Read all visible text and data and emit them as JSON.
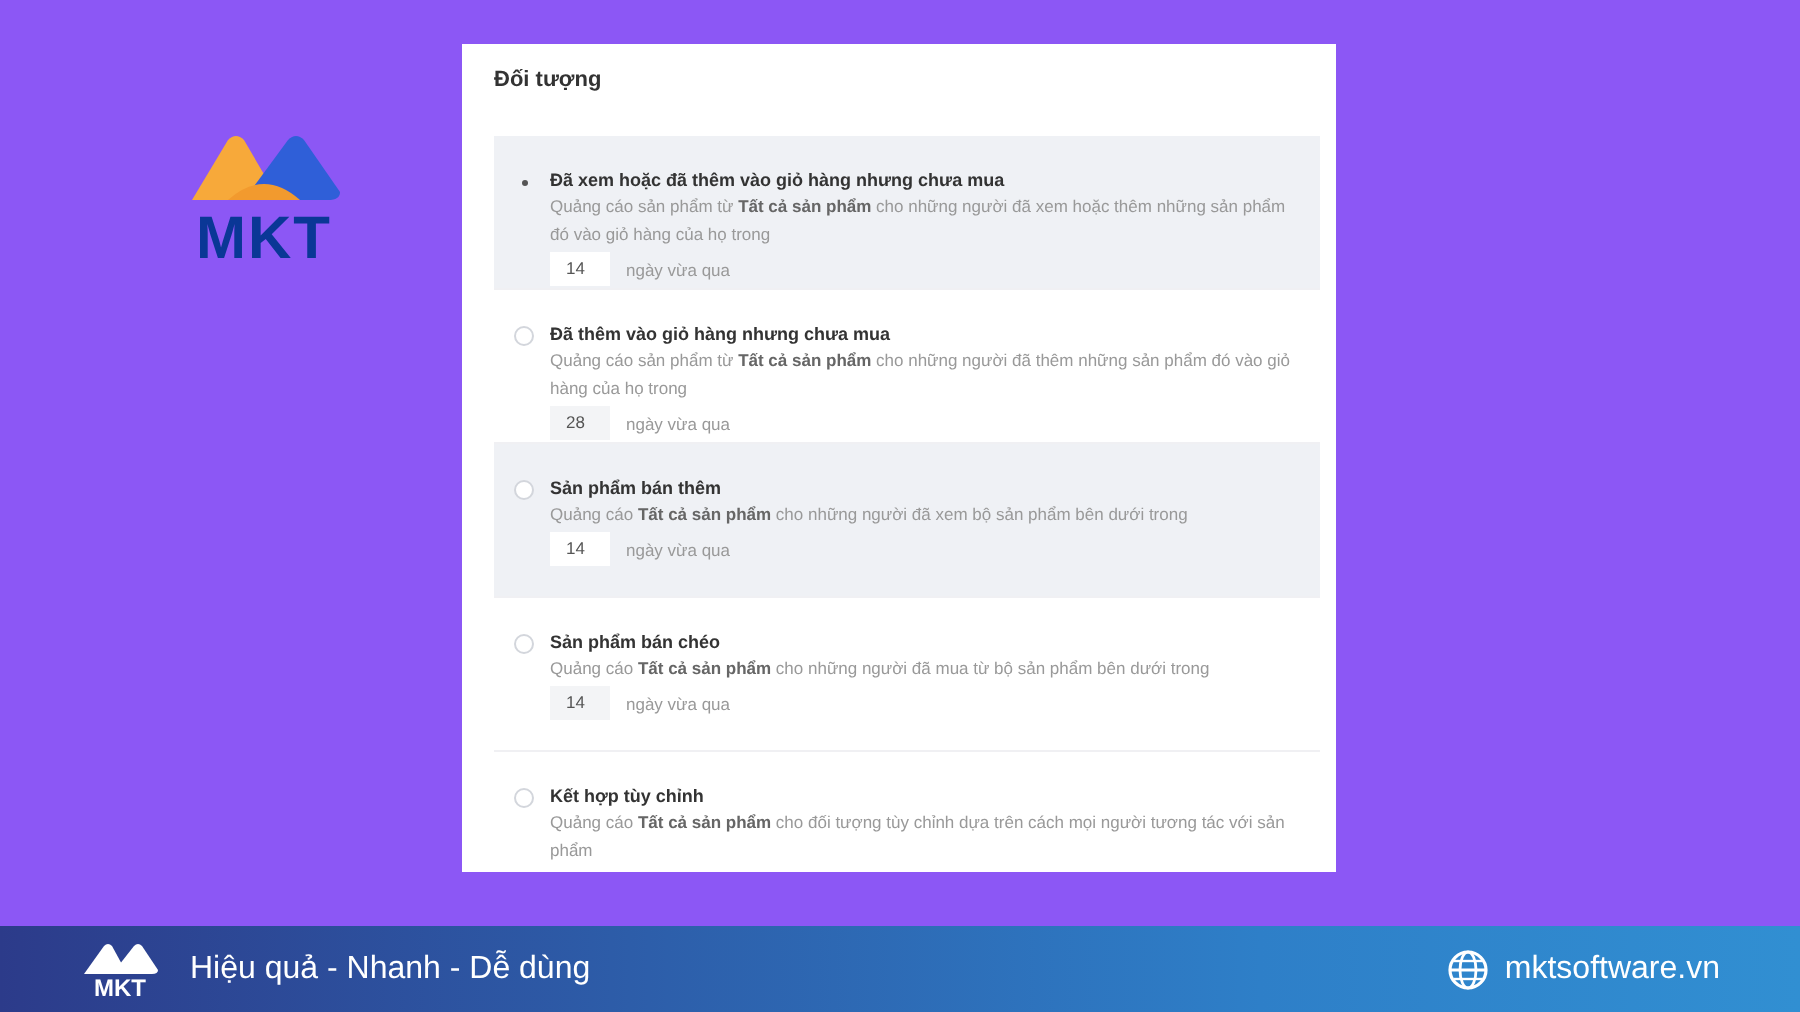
{
  "card": {
    "title": "Đối tượng",
    "options": [
      {
        "label": "Đã xem hoặc đã thêm vào giỏ hàng nhưng chưa mua",
        "selected": true,
        "highlighted": true,
        "description": "Quảng cáo sản phẩm từ **Tất cả sản phẩm** cho những người đã xem hoặc thêm những sản phẩm đó vào giỏ hàng của họ trong",
        "days": "14",
        "suffix": "ngày vừa qua"
      },
      {
        "label": "Đã thêm vào giỏ hàng nhưng chưa mua",
        "selected": false,
        "highlighted": false,
        "description": "Quảng cáo sản phẩm từ **Tất cả sản phẩm** cho những người đã thêm những sản phẩm đó vào giỏ hàng của họ trong",
        "days": "28",
        "suffix": "ngày vừa qua"
      },
      {
        "label": "Sản phẩm bán thêm",
        "selected": false,
        "highlighted": true,
        "description": "Quảng cáo **Tất cả sản phẩm** cho những người đã xem bộ sản phẩm bên dưới trong",
        "days": "14",
        "suffix": "ngày vừa qua"
      },
      {
        "label": "Sản phẩm bán chéo",
        "selected": false,
        "highlighted": false,
        "description": "Quảng cáo **Tất cả sản phẩm** cho những người đã mua từ bộ sản phẩm bên dưới trong",
        "days": "14",
        "suffix": "ngày vừa qua"
      },
      {
        "label": "Kết hợp tùy chỉnh",
        "selected": false,
        "highlighted": false,
        "description": "Quảng cáo **Tất cả sản phẩm** cho đối tượng tùy chỉnh dựa trên cách mọi người tương tác với sản phẩm"
      }
    ]
  },
  "footer": {
    "logo_text": "MKT",
    "tagline": "Hiệu quả - Nhanh - Dễ dùng",
    "website": "mktsoftware.vn"
  },
  "brand": {
    "logo_text": "MKT"
  }
}
